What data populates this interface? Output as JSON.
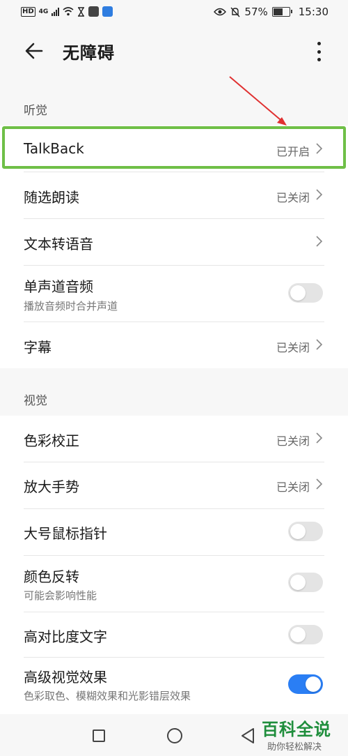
{
  "status_bar": {
    "hd": "HD",
    "network": "4G",
    "battery": "57%",
    "battery_level": 0.57,
    "time": "15:30",
    "icons": [
      "signal-icon",
      "wifi-icon",
      "hourglass-icon",
      "app-notification-icon",
      "eye-comfort-icon",
      "mute-bell-icon",
      "battery-icon"
    ]
  },
  "header": {
    "title": "无障碍",
    "back_icon": "back-arrow-icon",
    "more_icon": "more-vertical-icon"
  },
  "hearing": {
    "header": "听觉",
    "items": [
      {
        "label": "TalkBack",
        "value": "已开启",
        "type": "nav"
      },
      {
        "label": "随选朗读",
        "value": "已关闭",
        "type": "nav"
      },
      {
        "label": "文本转语音",
        "value": "",
        "type": "nav"
      },
      {
        "label": "单声道音频",
        "sub": "播放音频时合并声道",
        "type": "toggle",
        "on": false
      },
      {
        "label": "字幕",
        "value": "已关闭",
        "type": "nav"
      }
    ]
  },
  "vision": {
    "header": "视觉",
    "items": [
      {
        "label": "色彩校正",
        "value": "已关闭",
        "type": "nav"
      },
      {
        "label": "放大手势",
        "value": "已关闭",
        "type": "nav"
      },
      {
        "label": "大号鼠标指针",
        "type": "toggle",
        "on": false
      },
      {
        "label": "颜色反转",
        "sub": "可能会影响性能",
        "type": "toggle",
        "on": false
      },
      {
        "label": "高对比度文字",
        "type": "toggle",
        "on": false
      },
      {
        "label": "高级视觉效果",
        "sub": "色彩取色、模糊效果和光影错层效果",
        "type": "toggle",
        "on": true
      }
    ]
  },
  "annotation": {
    "highlight_color": "#6fbf47",
    "arrow_color": "#e03030"
  },
  "nav_bar": {
    "icons": [
      "recent-apps-icon",
      "home-icon",
      "back-triangle-icon"
    ]
  },
  "watermark": {
    "title": "百科全说",
    "subtitle": "助你轻松解决"
  },
  "colors": {
    "accent": "#2a7ef4",
    "background": "#f7f7f7"
  }
}
